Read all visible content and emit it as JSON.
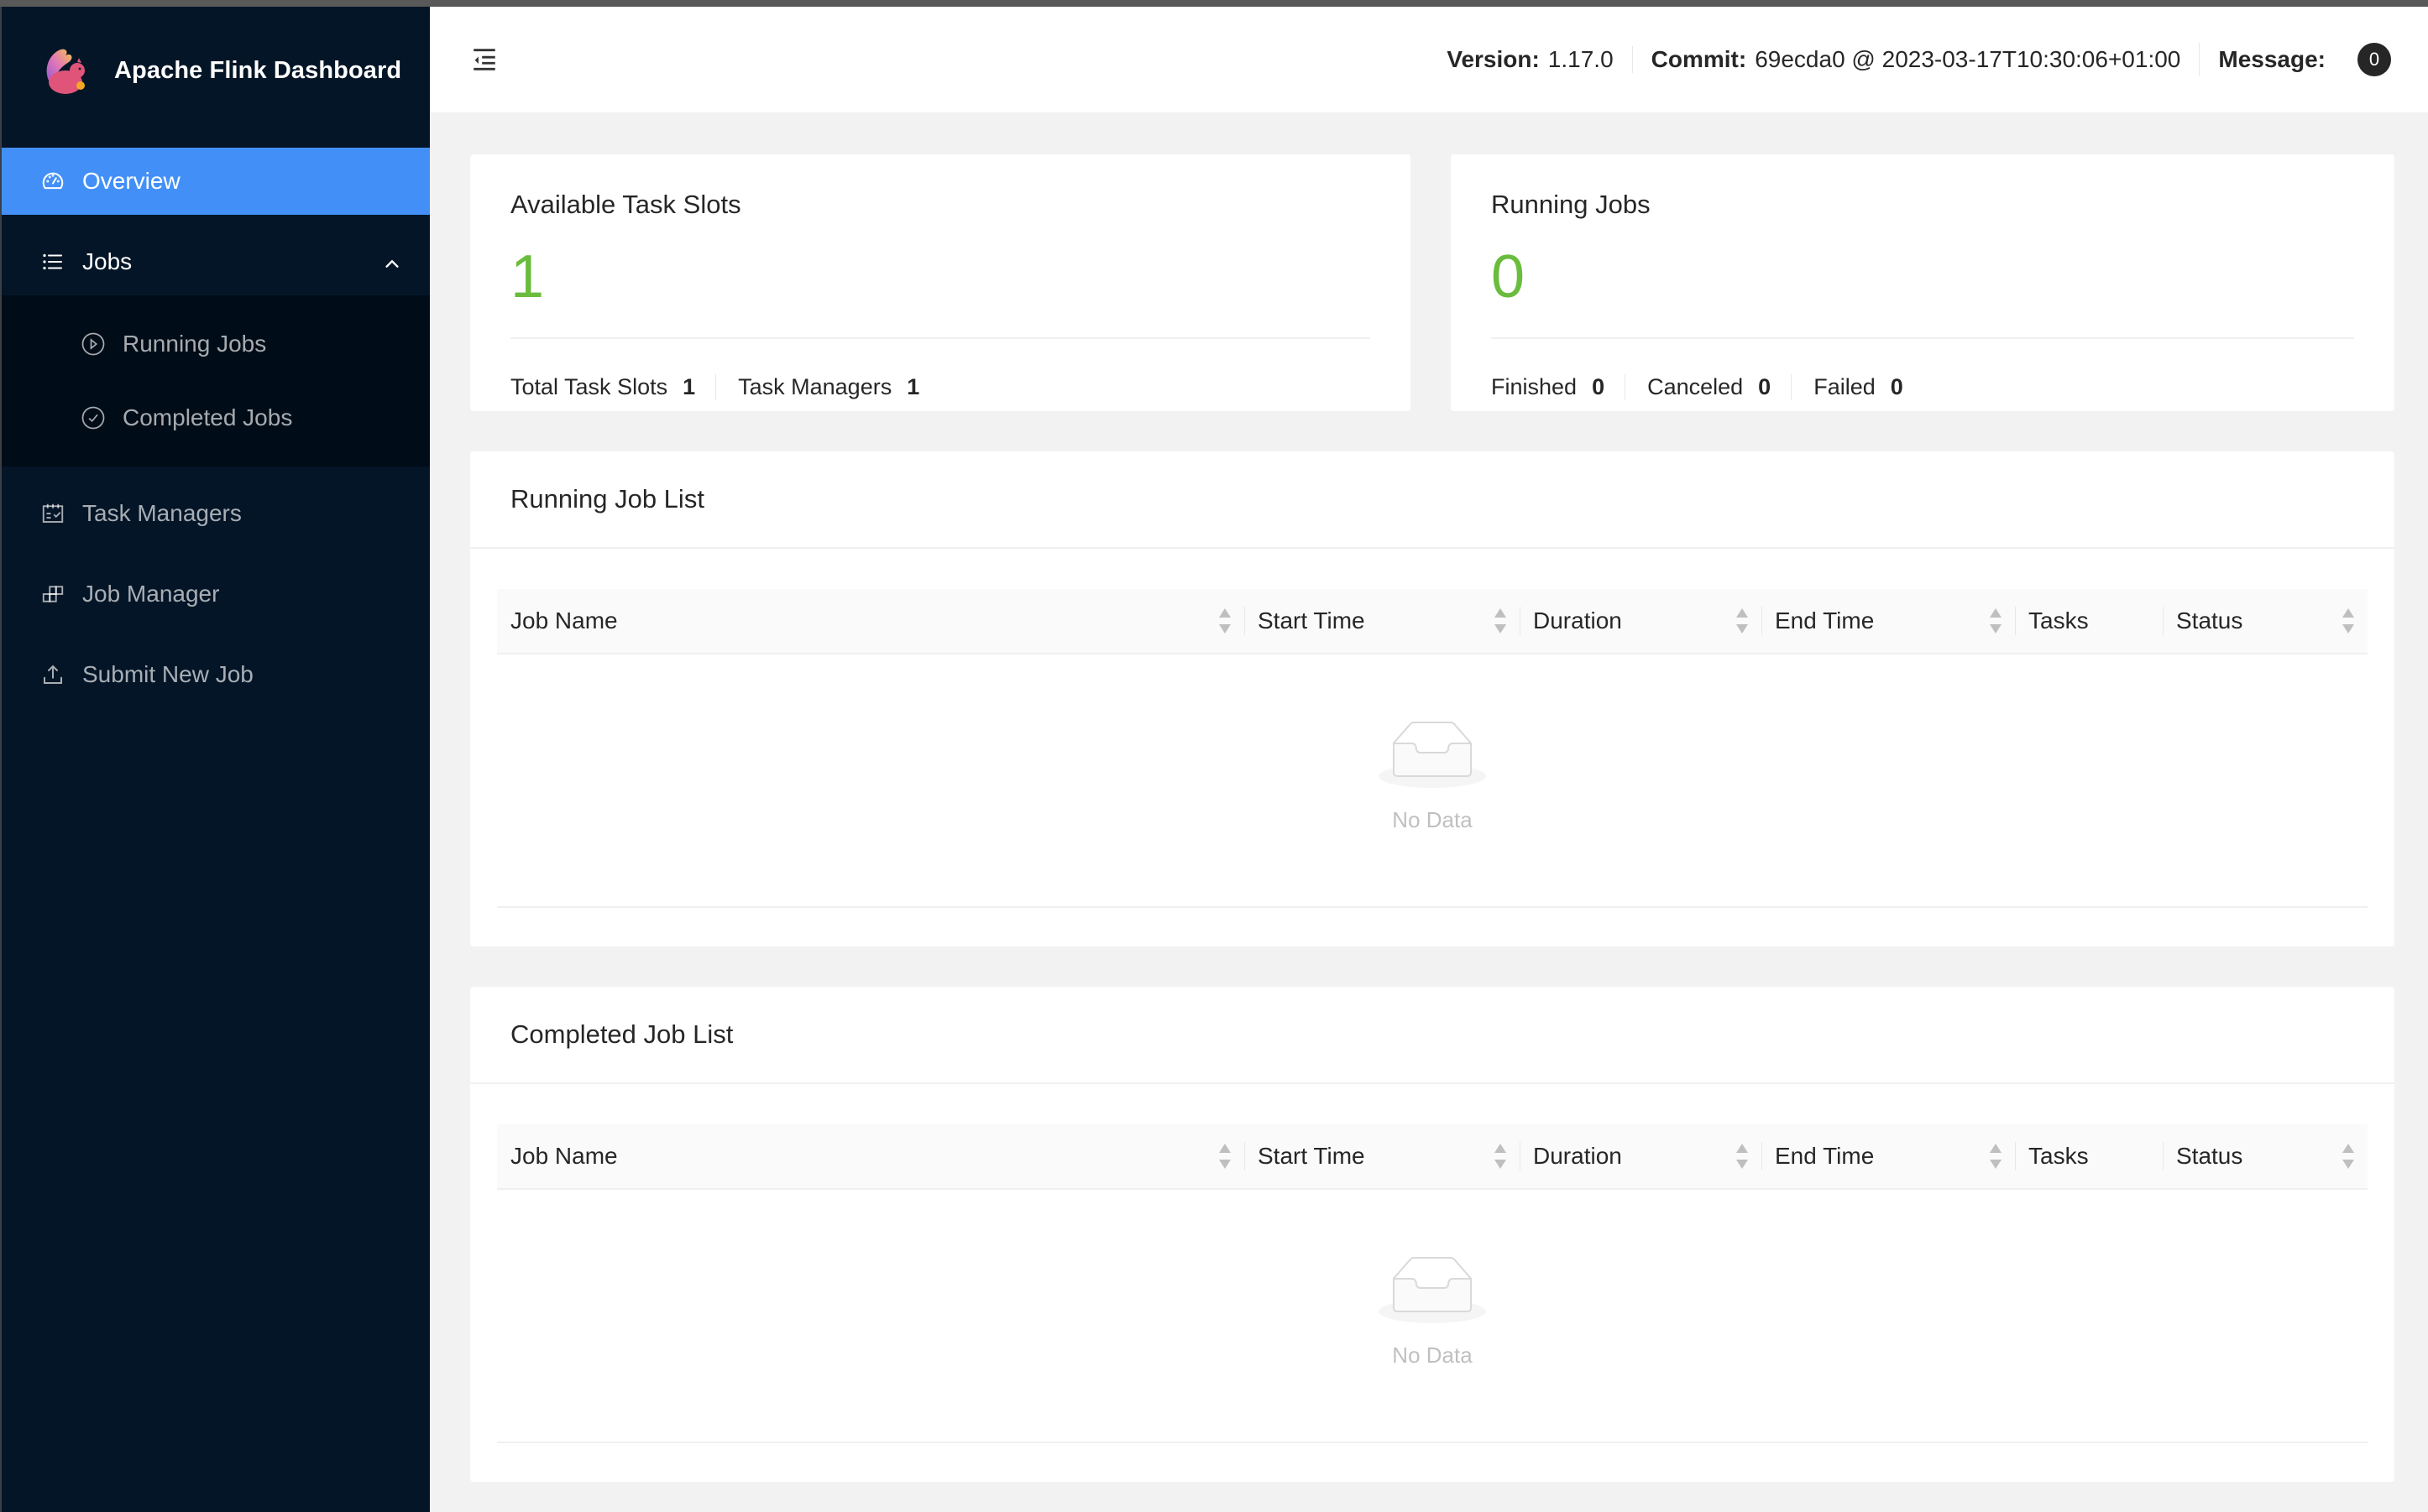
{
  "app": {
    "title": "Apache Flink Dashboard",
    "logo_icon": "flink-squirrel-logo"
  },
  "sidebar": {
    "items": [
      {
        "label": "Overview",
        "icon": "dashboard-icon",
        "active": true
      },
      {
        "label": "Jobs",
        "icon": "unordered-list-icon",
        "expanded": true,
        "children": [
          {
            "label": "Running Jobs",
            "icon": "play-circle-icon"
          },
          {
            "label": "Completed Jobs",
            "icon": "check-circle-icon"
          }
        ]
      },
      {
        "label": "Task Managers",
        "icon": "schedule-icon"
      },
      {
        "label": "Job Manager",
        "icon": "build-icon"
      },
      {
        "label": "Submit New Job",
        "icon": "upload-icon"
      }
    ]
  },
  "header": {
    "menu_toggle_icon": "menu-fold-icon",
    "version_label": "Version:",
    "version_value": "1.17.0",
    "commit_label": "Commit:",
    "commit_value": "69ecda0 @ 2023-03-17T10:30:06+01:00",
    "message_label": "Message:",
    "message_count": "0"
  },
  "overview": {
    "task_slots": {
      "title": "Available Task Slots",
      "value": "1",
      "footer": [
        {
          "label": "Total Task Slots",
          "value": "1"
        },
        {
          "label": "Task Managers",
          "value": "1"
        }
      ]
    },
    "running_jobs": {
      "title": "Running Jobs",
      "value": "0",
      "footer": [
        {
          "label": "Finished",
          "value": "0"
        },
        {
          "label": "Canceled",
          "value": "0"
        },
        {
          "label": "Failed",
          "value": "0"
        }
      ]
    }
  },
  "running_list": {
    "title": "Running Job List",
    "columns": [
      "Job Name",
      "Start Time",
      "Duration",
      "End Time",
      "Tasks",
      "Status"
    ],
    "rows": [],
    "empty_text": "No Data"
  },
  "completed_list": {
    "title": "Completed Job List",
    "columns": [
      "Job Name",
      "Start Time",
      "Duration",
      "End Time",
      "Tasks",
      "Status"
    ],
    "rows": [],
    "empty_text": "No Data"
  },
  "colors": {
    "sidebar_bg": "#041527",
    "submenu_bg": "#000c17",
    "active_item": "#4290f7",
    "stat_value": "#6abc3d",
    "badge_bg": "#262626"
  }
}
